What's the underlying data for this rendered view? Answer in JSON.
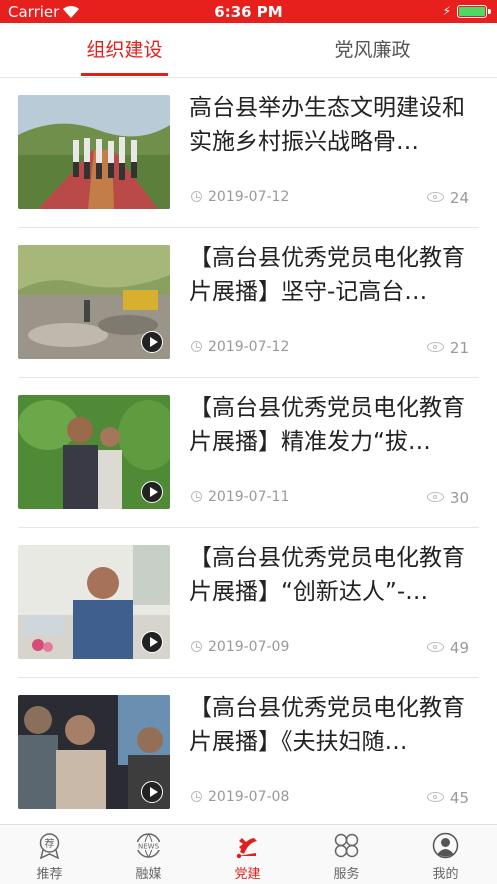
{
  "status_bar": {
    "carrier": "Carrier",
    "time": "6:36 PM"
  },
  "tabs": [
    {
      "label": "组织建设",
      "active": true
    },
    {
      "label": "党风廉政",
      "active": false
    }
  ],
  "articles": [
    {
      "title": "高台县举办生态文明建设和实施乡村振兴战略骨…",
      "date": "2019-07-12",
      "views": "24",
      "video": false
    },
    {
      "title": "【高台县优秀党员电化教育片展播】坚守-记高台…",
      "date": "2019-07-12",
      "views": "21",
      "video": true
    },
    {
      "title": "【高台县优秀党员电化教育片展播】精准发力“拔…",
      "date": "2019-07-11",
      "views": "30",
      "video": true
    },
    {
      "title": "【高台县优秀党员电化教育片展播】“创新达人”-…",
      "date": "2019-07-09",
      "views": "49",
      "video": true
    },
    {
      "title": "【高台县优秀党员电化教育片展播】《夫扶妇随…",
      "date": "2019-07-08",
      "views": "45",
      "video": true
    }
  ],
  "bottom_nav": [
    {
      "label": "推荐",
      "icon": "recommend-badge-icon"
    },
    {
      "label": "融媒",
      "icon": "news-globe-icon"
    },
    {
      "label": "党建",
      "icon": "party-emblem-icon",
      "active": true
    },
    {
      "label": "服务",
      "icon": "service-grid-icon"
    },
    {
      "label": "我的",
      "icon": "user-profile-icon"
    }
  ],
  "colors": {
    "accent": "#e0211b",
    "status_bar": "#e8201d"
  }
}
